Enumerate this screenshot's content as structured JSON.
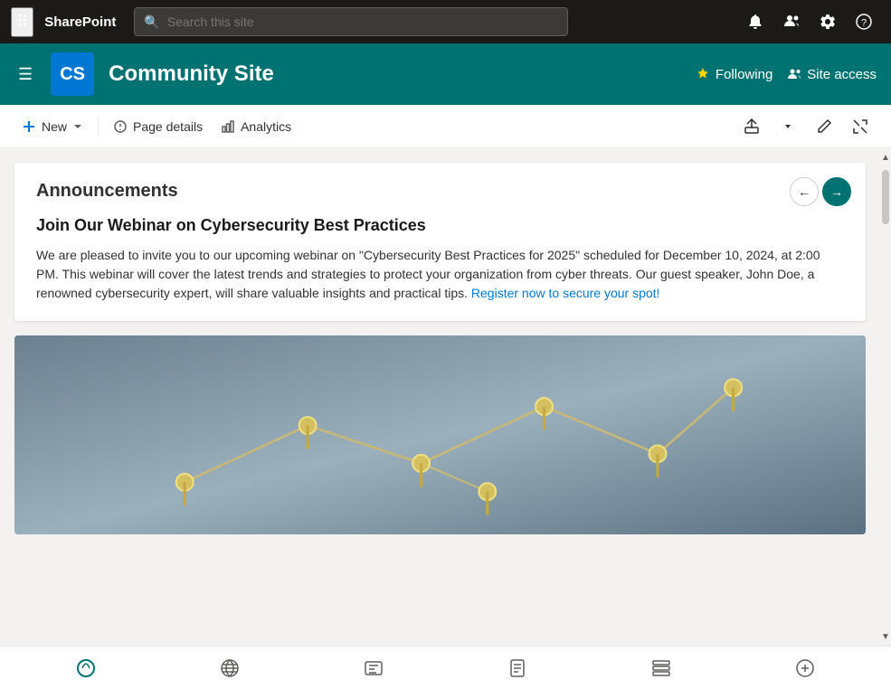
{
  "app": {
    "name": "SharePoint"
  },
  "topnav": {
    "search_placeholder": "Search this site",
    "icons": [
      "notification",
      "people",
      "settings",
      "help"
    ]
  },
  "site_header": {
    "logo_text": "CS",
    "title": "Community Site",
    "following_label": "Following",
    "site_access_label": "Site access"
  },
  "toolbar": {
    "new_label": "New",
    "page_details_label": "Page details",
    "analytics_label": "Analytics"
  },
  "announcements": {
    "title": "Announcements",
    "announcement_title": "Join Our Webinar on Cybersecurity Best Practices",
    "announcement_body": "We are pleased to invite you to our upcoming webinar on \"Cybersecurity Best Practices for 2025\" scheduled for December 10, 2024, at 2:00 PM. This webinar will cover the latest trends and strategies to protect your organization from cyber threats. Our guest speaker, John Doe, a renowned cybersecurity expert, will share valuable insights and practical tips. Register now to secure your spot!"
  },
  "bottom_bar": {
    "icons": [
      "viva",
      "globe",
      "news",
      "page",
      "list",
      "add"
    ]
  }
}
